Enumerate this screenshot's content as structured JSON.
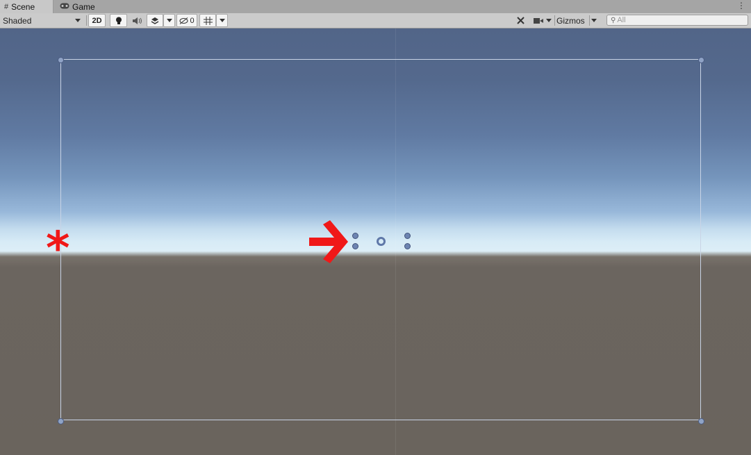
{
  "tabs": [
    {
      "label": "Scene",
      "icon": "grid-icon",
      "active": true
    },
    {
      "label": "Game",
      "icon": "gamepad-icon",
      "active": false
    }
  ],
  "toolbar": {
    "draw_mode": "Shaded",
    "toggle_2d": "2D",
    "hidden_count": "0",
    "gizmos_label": "Gizmos"
  },
  "search": {
    "placeholder": "All"
  },
  "annotations": {
    "asterisk": "*",
    "arrow_color": "#f01818"
  },
  "colors": {
    "sky_top": "#526588",
    "horizon": "#ddeef7",
    "ground": "#6a645d",
    "camera_frame": "#c9d4e6"
  }
}
